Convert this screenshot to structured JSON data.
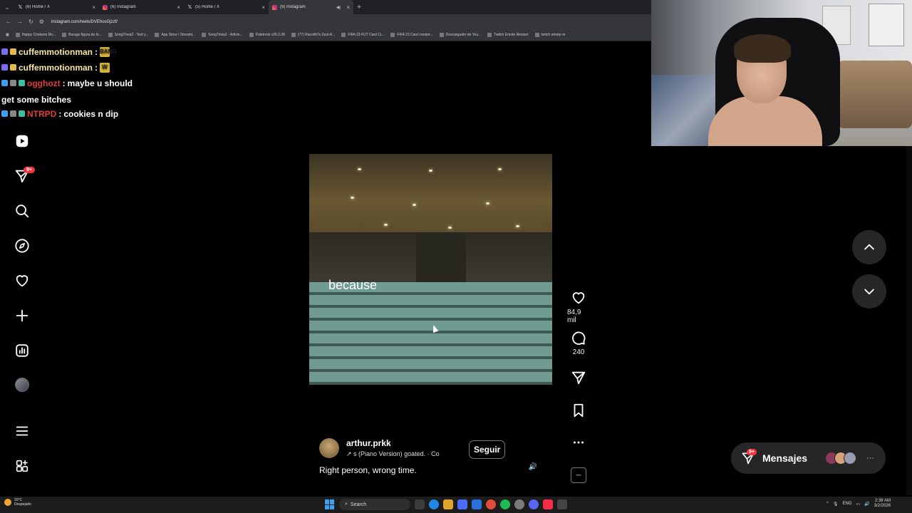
{
  "browser": {
    "tabs": [
      {
        "title": "(6) Home / X",
        "icon": "x",
        "active": false
      },
      {
        "title": "(6) Instagram",
        "icon": "ig",
        "active": false
      },
      {
        "title": "(5) Home / X",
        "icon": "x",
        "active": false
      },
      {
        "title": "(9) Instagram",
        "icon": "ig",
        "active": true
      }
    ],
    "url": "instagram.com/reels/DVEhosGjzzf/",
    "bookmarks": [
      "Happy Cristiano Ro...",
      "Burago figura de lo...",
      "SongTrivia2 - Test y...",
      "App Store / Streami...",
      "SongTrivia2 - Adivin...",
      "Paletools v26.0.28",
      "(77) Racoli97s Zest-A...",
      "FIFA 23 FUT Card Cr...",
      "FIFA 23 Card creator...",
      "Descargador de You...",
      "Twitch Emote Resizer",
      "twitch emote re"
    ]
  },
  "chat": [
    {
      "user": "cuffemmotionman",
      "sep": " :",
      "text": "",
      "color": "#f6e6a0",
      "emote": "BANG"
    },
    {
      "user": "cuffemmotionman",
      "sep": " :",
      "text": "",
      "color": "#f6e6a0",
      "emote": "W"
    },
    {
      "user": "ogghozt",
      "sep": " :",
      "text": "maybe u should",
      "text2": "get some bitches",
      "color": "#e23c3c"
    },
    {
      "user": "NTRPD",
      "sep": " :",
      "text": "cookies n dip",
      "color": "#e23c3c"
    }
  ],
  "sidebar": {
    "notification_count": "9+"
  },
  "reel": {
    "caption_word": "because",
    "username": "arthur.prkk",
    "audio": "↗  s (Piano Version)  goated. · Co",
    "follow_label": "Seguir",
    "description": "Right person, wrong time.",
    "likes": "84,9 mil",
    "comments": "240"
  },
  "messages": {
    "label": "Mensajes",
    "badge": "9+"
  },
  "taskbar": {
    "weather_temp": "20°C",
    "weather_desc": "Despejado",
    "search_label": "Search",
    "lang": "ENG",
    "time": "2:38 AM",
    "date": "3/2/2026"
  }
}
